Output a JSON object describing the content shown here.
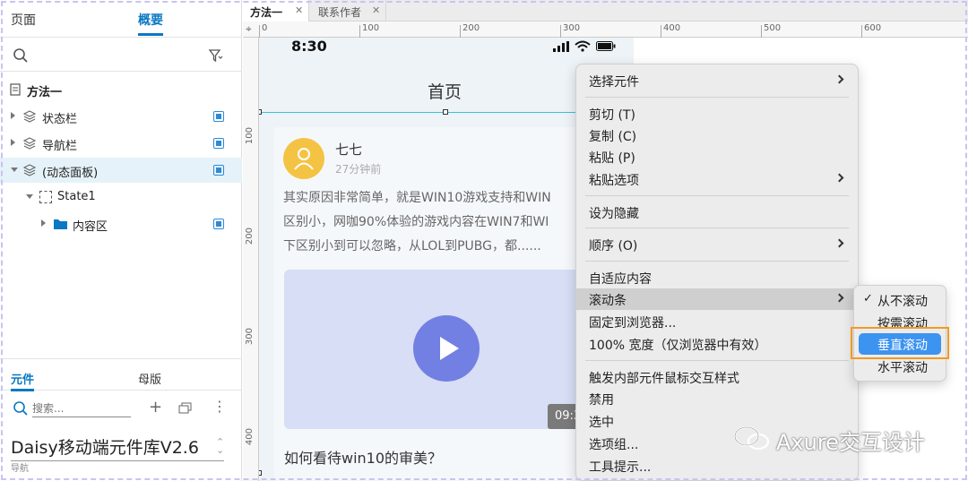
{
  "left_panel": {
    "tabs": [
      "页面",
      "概要"
    ],
    "tree": {
      "root": "方法一",
      "items": [
        {
          "label": "状态栏"
        },
        {
          "label": "导航栏"
        },
        {
          "label": "(动态面板)"
        },
        {
          "label": "State1"
        },
        {
          "label": "内容区"
        }
      ]
    },
    "bottom_tabs": [
      "元件",
      "母版"
    ],
    "library_search_placeholder": "搜索...",
    "library_name": "Daisy移动端元件库V2.6",
    "library_sub": "导航"
  },
  "doc_tabs": [
    {
      "label": "方法一",
      "close": "✕"
    },
    {
      "label": "联系作者",
      "close": "✕"
    }
  ],
  "ruler": {
    "top": [
      "0",
      "100",
      "200",
      "300",
      "400",
      "500",
      "600"
    ],
    "left": [
      "100",
      "200",
      "300",
      "400"
    ]
  },
  "phone": {
    "time": "8:30",
    "nav_title": "首页",
    "post": {
      "user": "七七",
      "time": "27分钟前",
      "lines": [
        "其实原因非常简单，就是WIN10游戏支持和WIN",
        "区别小，网咖90%体验的游戏内容在WIN7和WI",
        "下区别小到可以忽略，从LOL到PUBG，都......"
      ],
      "video_duration": "09:3",
      "question": "如何看待win10的审美？"
    }
  },
  "context_menu": {
    "items": [
      {
        "label": "选择元件",
        "submenu": true
      },
      {
        "label": "剪切 (T)"
      },
      {
        "label": "复制 (C)"
      },
      {
        "label": "粘贴 (P)"
      },
      {
        "label": "粘贴选项",
        "submenu": true
      },
      {
        "label": "设为隐藏"
      },
      {
        "label": "顺序 (O)",
        "submenu": true
      },
      {
        "label": "自适应内容"
      },
      {
        "label": "滚动条",
        "submenu": true,
        "highlighted": true
      },
      {
        "label": "固定到浏览器..."
      },
      {
        "label": "100% 宽度（仅浏览器中有效）"
      },
      {
        "label": "触发内部元件鼠标交互样式"
      },
      {
        "label": "禁用"
      },
      {
        "label": "选中"
      },
      {
        "label": "选项组..."
      },
      {
        "label": "工具提示..."
      }
    ]
  },
  "scroll_submenu": {
    "items": [
      {
        "label": "从不滚动",
        "checked": true
      },
      {
        "label": "按需滚动"
      },
      {
        "label": "垂直滚动",
        "highlighted": true
      },
      {
        "label": "水平滚动"
      }
    ],
    "check_glyph": "✓"
  },
  "watermark": "Axure交互设计",
  "colors": {
    "accent": "#0a78c2",
    "selection": "#39c0d8",
    "avatar": "#f5c343",
    "play": "#7280e3",
    "submenu_highlight": "#3d93f0",
    "callout": "#f29a20"
  }
}
